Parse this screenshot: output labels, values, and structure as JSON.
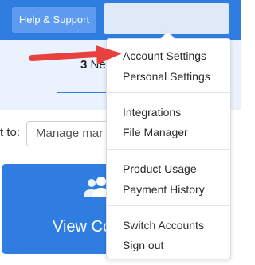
{
  "topbar": {
    "help_label": "Help & Support"
  },
  "tabs": {
    "count": "3",
    "label_partial": "Ne"
  },
  "assign": {
    "label_partial": "t to:",
    "input_value": "Manage mar"
  },
  "view_card": {
    "label": "View Co",
    "icon": "users-icon"
  },
  "menu": {
    "groups": [
      {
        "items": [
          "Account Settings",
          "Personal Settings"
        ]
      },
      {
        "items": [
          "Integrations",
          "File Manager"
        ]
      },
      {
        "items": [
          "Product Usage",
          "Payment History"
        ]
      },
      {
        "items": [
          "Switch Accounts",
          "Sign out"
        ]
      }
    ]
  },
  "colors": {
    "brand_blue": "#2f7de1",
    "annotation_red": "#e8403f"
  }
}
